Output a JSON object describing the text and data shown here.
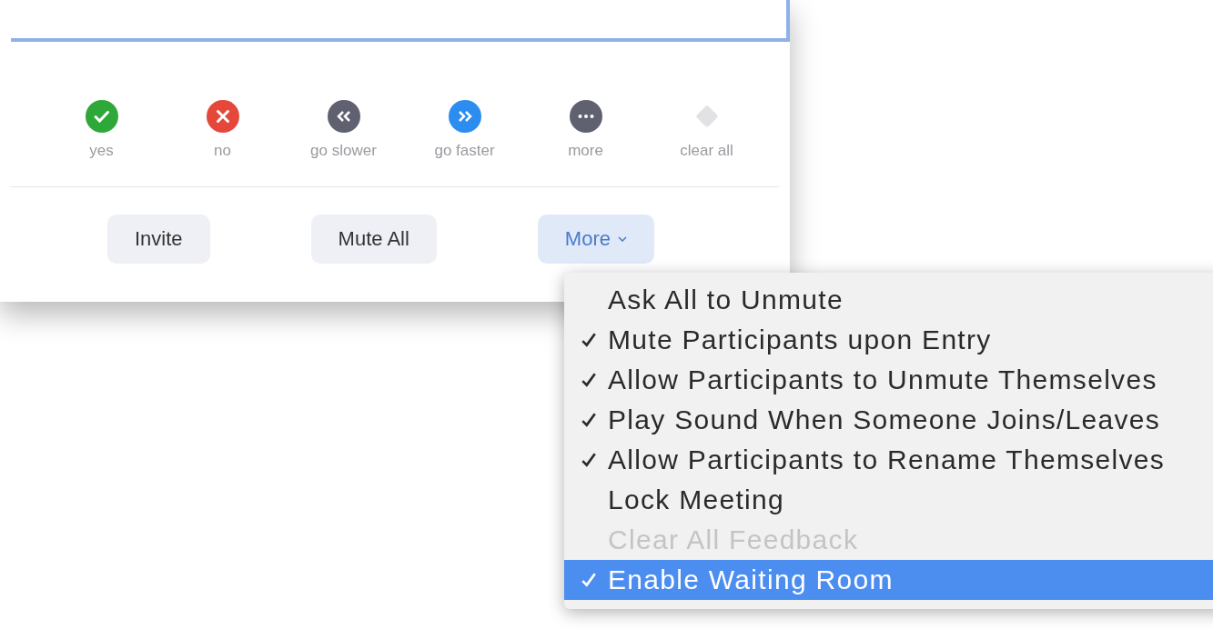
{
  "reactions": [
    {
      "kind": "yes",
      "label": "yes"
    },
    {
      "kind": "no",
      "label": "no"
    },
    {
      "kind": "slower",
      "label": "go slower"
    },
    {
      "kind": "faster",
      "label": "go faster"
    },
    {
      "kind": "more",
      "label": "more"
    },
    {
      "kind": "clear",
      "label": "clear all"
    }
  ],
  "buttons": [
    {
      "label": "Invite",
      "selected": false,
      "dropdown": false
    },
    {
      "label": "Mute All",
      "selected": false,
      "dropdown": false
    },
    {
      "label": "More",
      "selected": true,
      "dropdown": true
    }
  ],
  "menu": {
    "items": [
      {
        "label": "Ask All to Unmute",
        "checked": false,
        "disabled": false,
        "selected": false
      },
      {
        "label": "Mute Participants upon Entry",
        "checked": true,
        "disabled": false,
        "selected": false
      },
      {
        "label": "Allow Participants to Unmute Themselves",
        "checked": true,
        "disabled": false,
        "selected": false
      },
      {
        "label": "Play Sound When Someone Joins/Leaves",
        "checked": true,
        "disabled": false,
        "selected": false
      },
      {
        "label": "Allow Participants to Rename Themselves",
        "checked": true,
        "disabled": false,
        "selected": false
      },
      {
        "label": "Lock Meeting",
        "checked": false,
        "disabled": false,
        "selected": false
      },
      {
        "label": "Clear All Feedback",
        "checked": false,
        "disabled": true,
        "selected": false
      },
      {
        "label": "Enable Waiting Room",
        "checked": true,
        "disabled": false,
        "selected": true
      }
    ]
  }
}
